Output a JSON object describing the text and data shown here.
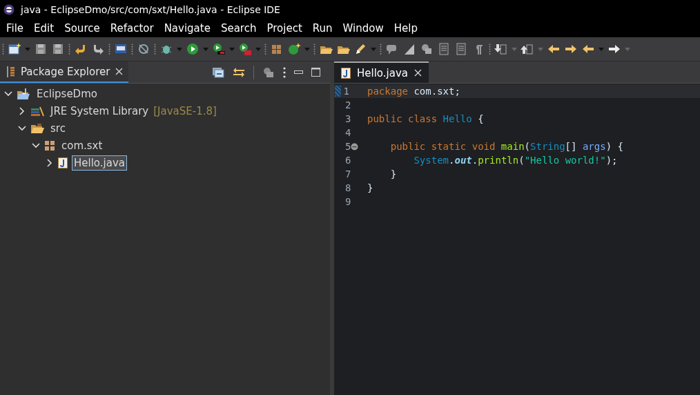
{
  "window": {
    "title": "java - EclipseDmo/src/com/sxt/Hello.java - Eclipse IDE"
  },
  "menu": [
    "File",
    "Edit",
    "Source",
    "Refactor",
    "Navigate",
    "Search",
    "Project",
    "Run",
    "Window",
    "Help"
  ],
  "explorer": {
    "tab": {
      "label": "Package Explorer",
      "selected": true
    },
    "tree": [
      {
        "label": "EclipseDmo",
        "kind": "project",
        "expanded": true,
        "selected": false,
        "children": [
          {
            "label": "JRE System Library",
            "decoration": "[JavaSE-1.8]",
            "kind": "library",
            "expanded": false,
            "selected": false
          },
          {
            "label": "src",
            "kind": "folder",
            "expanded": true,
            "selected": false,
            "children": [
              {
                "label": "com.sxt",
                "kind": "package",
                "expanded": true,
                "selected": false,
                "children": [
                  {
                    "label": "Hello.java",
                    "kind": "file",
                    "expanded": false,
                    "selected": true
                  }
                ]
              }
            ]
          }
        ]
      }
    ]
  },
  "editor": {
    "tab": {
      "label": "Hello.java",
      "selected": true
    },
    "lines": [
      {
        "number": "1",
        "current": true,
        "fold": false,
        "tokens": [
          {
            "kind": "keyword",
            "text": "package"
          },
          {
            "kind": "plain",
            "text": " com.sxt;"
          }
        ]
      },
      {
        "number": "2",
        "current": false,
        "fold": false
      },
      {
        "number": "3",
        "current": false,
        "fold": false,
        "tokens": [
          {
            "kind": "keyword",
            "text": "public class"
          },
          {
            "kind": "type",
            "text": " Hello"
          },
          {
            "kind": "plain",
            "text": " {"
          }
        ]
      },
      {
        "number": "4",
        "current": false,
        "fold": false
      },
      {
        "number": "5",
        "current": false,
        "fold": true,
        "tokens": [
          {
            "kind": "keyword",
            "text": "    public static void"
          },
          {
            "kind": "method",
            "text": " main"
          },
          {
            "kind": "plain",
            "text": "("
          },
          {
            "kind": "type",
            "text": "String"
          },
          {
            "kind": "plain",
            "text": "[] "
          },
          {
            "kind": "param",
            "text": "args"
          },
          {
            "kind": "plain",
            "text": ") {"
          }
        ]
      },
      {
        "number": "6",
        "current": false,
        "fold": false,
        "tokens": [
          {
            "kind": "type",
            "text": "        System"
          },
          {
            "kind": "plain",
            "text": "."
          },
          {
            "kind": "field",
            "text": "out"
          },
          {
            "kind": "plain",
            "text": "."
          },
          {
            "kind": "method",
            "text": "println"
          },
          {
            "kind": "plain",
            "text": "("
          },
          {
            "kind": "string",
            "text": "\"Hello world!\""
          },
          {
            "kind": "plain",
            "text": ");"
          }
        ]
      },
      {
        "number": "7",
        "current": false,
        "fold": false,
        "tokens": [
          {
            "kind": "plain",
            "text": "    }"
          }
        ]
      },
      {
        "number": "8",
        "current": false,
        "fold": false,
        "tokens": [
          {
            "kind": "plain",
            "text": "}"
          }
        ]
      },
      {
        "number": "9",
        "current": false,
        "fold": false
      }
    ]
  }
}
